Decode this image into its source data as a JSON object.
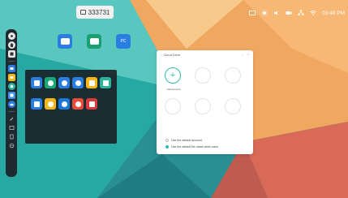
{
  "room": {
    "label": "333731"
  },
  "status": {
    "time": "03:48 PM"
  },
  "dock": {
    "items": [
      "settings-icon",
      "home-icon",
      "window-icon",
      "folder-icon",
      "folder-yellow-icon",
      "browser-icon",
      "whiteboard-icon",
      "cloud-icon",
      "pen-icon",
      "screen-icon",
      "file-icon",
      "more-icon"
    ]
  },
  "desktop": {
    "icons": [
      {
        "label": "",
        "color": "#2a7de1"
      },
      {
        "label": "",
        "color": "#19a06e"
      },
      {
        "label": "",
        "color": "#2a7de1"
      }
    ]
  },
  "drawer": {
    "apps": [
      {
        "label": "",
        "color": "#2a7de1"
      },
      {
        "label": "",
        "color": "#18a977"
      },
      {
        "label": "",
        "color": "#2a7de1"
      },
      {
        "label": "",
        "color": "#2a7de1"
      },
      {
        "label": "",
        "color": "#f3b71a"
      },
      {
        "label": "",
        "color": "#2bb69c"
      },
      {
        "label": "",
        "color": "#2a7de1"
      },
      {
        "label": "",
        "color": "#f3b71a"
      },
      {
        "label": "",
        "color": "#1d77d8"
      },
      {
        "label": "",
        "color": "#e94c3d"
      },
      {
        "label": "",
        "color": "#d9393a"
      }
    ]
  },
  "cloud_drive": {
    "title": "Cloud Drive",
    "add_account_label": "Add Account",
    "option_default_account": "Use the default account",
    "option_default_filename": "Use the default file name when save",
    "selected_option": "default_filename",
    "accent": "#2fb9a7"
  }
}
